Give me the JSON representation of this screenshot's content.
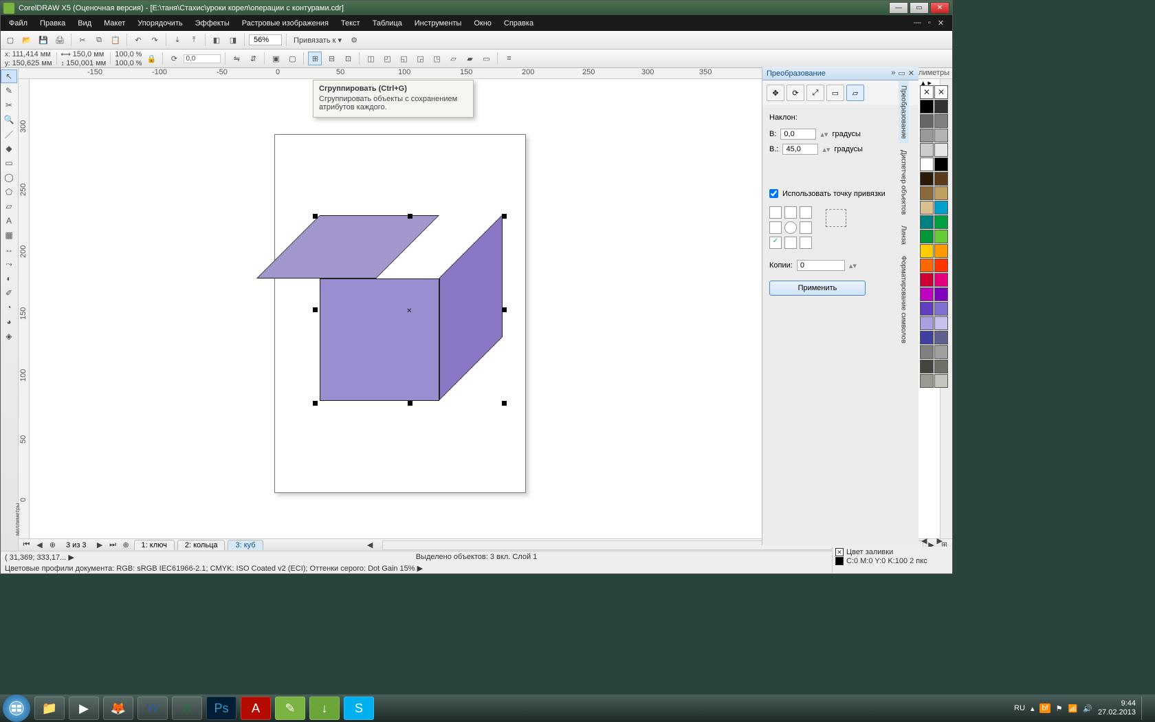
{
  "title": "CorelDRAW X5 (Оценочная версия) - [E:\\таня\\Стахис\\уроки корел\\операции с контурами.cdr]",
  "menu": [
    "Файл",
    "Правка",
    "Вид",
    "Макет",
    "Упорядочить",
    "Эффекты",
    "Растровые изображения",
    "Текст",
    "Таблица",
    "Инструменты",
    "Окно",
    "Справка"
  ],
  "toolbar": {
    "zoom": "56%",
    "snap": "Привязать к ▾"
  },
  "propbar": {
    "x": "111,414 мм",
    "y": "150,625 мм",
    "w": "150,0 мм",
    "h": "150,001 мм",
    "sx": "100,0",
    "sy": "100,0",
    "rot": "0,0"
  },
  "tooltip": {
    "title": "Сгруппировать (Ctrl+G)",
    "desc": "Сгруппировать объекты с сохранением атрибутов каждого."
  },
  "ruler": {
    "unit": "миллиметры",
    "top_ticks": [
      "-150",
      "-100",
      "-50",
      "0",
      "50",
      "100",
      "150",
      "200",
      "250",
      "300",
      "350"
    ],
    "left_ticks": [
      "300",
      "250",
      "200",
      "150",
      "100",
      "50",
      "0"
    ]
  },
  "nav": {
    "page_info": "3 из 3",
    "tabs": [
      "1: ключ",
      "2: кольца",
      "3: куб"
    ],
    "active_tab": 2
  },
  "status": {
    "coords": "( 31,369; 333,17... ▶",
    "selection": "Выделено объектов: 3 вкл. Слой 1",
    "profiles": "Цветовые профили документа: RGB: sRGB IEC61966-2.1; CMYK: ISO Coated v2 (ECI); Оттенки серого: Dot Gain 15% ▶",
    "fill_label": "Цвет заливки",
    "outline_info": "C:0 M:0 Y:0 K:100  2 пкс"
  },
  "docker": {
    "title": "Преобразование",
    "skew_label": "Наклон:",
    "h_label": "В:",
    "h_val": "0,0",
    "v_label": "В.:",
    "v_val": "45,0",
    "deg": "градусы",
    "anchor_label": "Использовать точку привязки",
    "copies_label": "Копии:",
    "copies_val": "0",
    "apply": "Применить"
  },
  "vtabs": [
    "Преобразование",
    "Диспетчер объектов",
    "Линза",
    "Форматирование символов"
  ],
  "palette": [
    "#000000",
    "#333333",
    "#666666",
    "#808080",
    "#999999",
    "#b3b3b3",
    "#cccccc",
    "#e6e6e6",
    "#ffffff",
    "#000000",
    "#2b1a0a",
    "#5b3b1a",
    "#8a6a3a",
    "#c0a060",
    "#d8c090",
    "#00a0c8",
    "#008080",
    "#00a040",
    "#009933",
    "#66cc33",
    "#ffcc00",
    "#ff9900",
    "#ff6600",
    "#ff3300",
    "#cc0033",
    "#e6007e",
    "#c000c0",
    "#8000c0",
    "#6040c0",
    "#8070d0",
    "#a8a0e0",
    "#c8c0f0",
    "#4040a0",
    "#606090",
    "#808080",
    "#a0a0a0",
    "#454540",
    "#707068",
    "#9a9a92",
    "#c5c5bd"
  ],
  "taskbar": {
    "lang": "RU",
    "time": "9:44",
    "date": "27.02.2013"
  }
}
